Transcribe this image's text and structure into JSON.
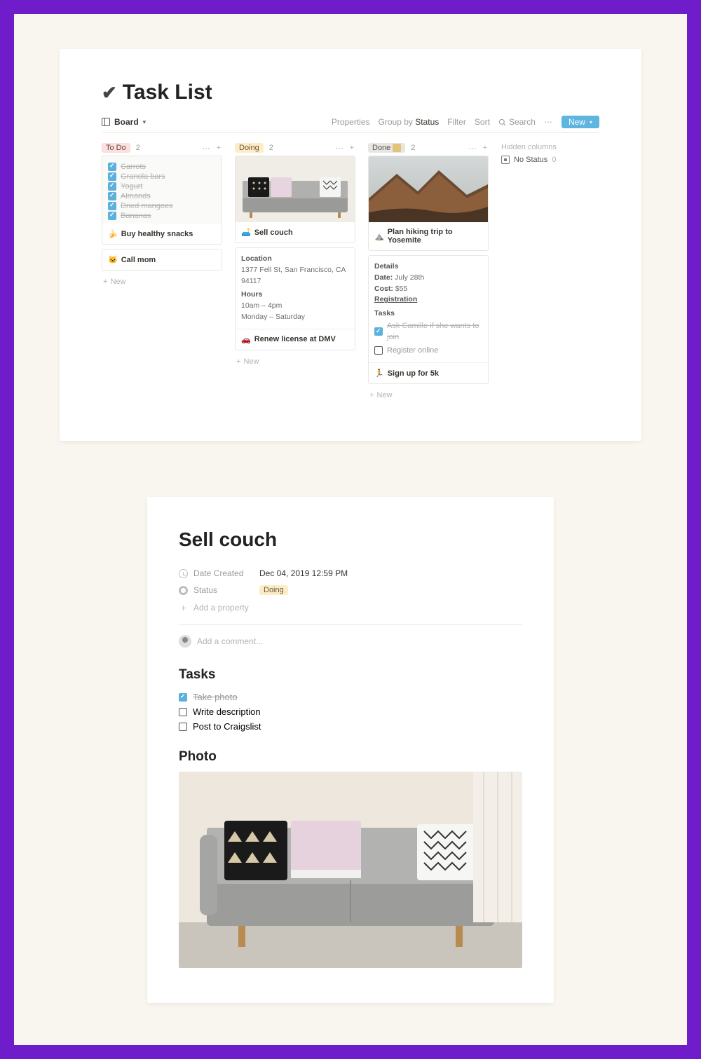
{
  "board": {
    "title_emoji": "✔",
    "title": "Task List",
    "view_label": "Board",
    "toolbar": {
      "properties": "Properties",
      "group_by_prefix": "Group by ",
      "group_by_value": "Status",
      "filter": "Filter",
      "sort": "Sort",
      "search": "Search",
      "new": "New"
    },
    "columns": {
      "todo": {
        "tag": "To Do",
        "count": "2",
        "card1": {
          "checks": [
            "Carrots",
            "Granola bars",
            "Yogurt",
            "Almonds",
            "Dried mangoes",
            "Bananas"
          ],
          "title_emoji": "🍌",
          "title": "Buy healthy snacks"
        },
        "card2": {
          "title_emoji": "🐱",
          "title": "Call mom"
        },
        "add": "New"
      },
      "doing": {
        "tag": "Doing",
        "count": "2",
        "card1": {
          "title_emoji": "🛋️",
          "title": "Sell couch"
        },
        "card2": {
          "loc_label": "Location",
          "loc_value": "1377 Fell St, San Francisco, CA 94117",
          "hours_label": "Hours",
          "hours_value": "10am – 4pm",
          "days": "Monday – Saturday",
          "title_emoji": "🚗",
          "title": "Renew license at DMV"
        },
        "add": "New"
      },
      "done": {
        "tag": "Done",
        "count": "2",
        "card1": {
          "title_emoji": "⛰️",
          "title": "Plan hiking trip to Yosemite"
        },
        "card2": {
          "details_label": "Details",
          "date_label": "Date:",
          "date_value": " July 28th",
          "cost_label": "Cost:",
          "cost_value": " $55",
          "reg_label": "Registration",
          "tasks_label": "Tasks",
          "check1": "Ask Camille if she wants to join",
          "check2": "Register online",
          "title_emoji": "🏃",
          "title": "Sign up for 5k"
        },
        "add": "New"
      },
      "hidden": {
        "label": "Hidden columns",
        "no_status": "No Status",
        "no_status_count": "0"
      }
    }
  },
  "detail": {
    "title": "Sell couch",
    "date_created_label": "Date Created",
    "date_created_value": "Dec 04, 2019 12:59 PM",
    "status_label": "Status",
    "status_value": "Doing",
    "add_property": "Add a property",
    "add_comment": "Add a comment...",
    "tasks_heading": "Tasks",
    "task1": "Take photo",
    "task2": "Write description",
    "task3": "Post to Craigslist",
    "photo_heading": "Photo"
  }
}
